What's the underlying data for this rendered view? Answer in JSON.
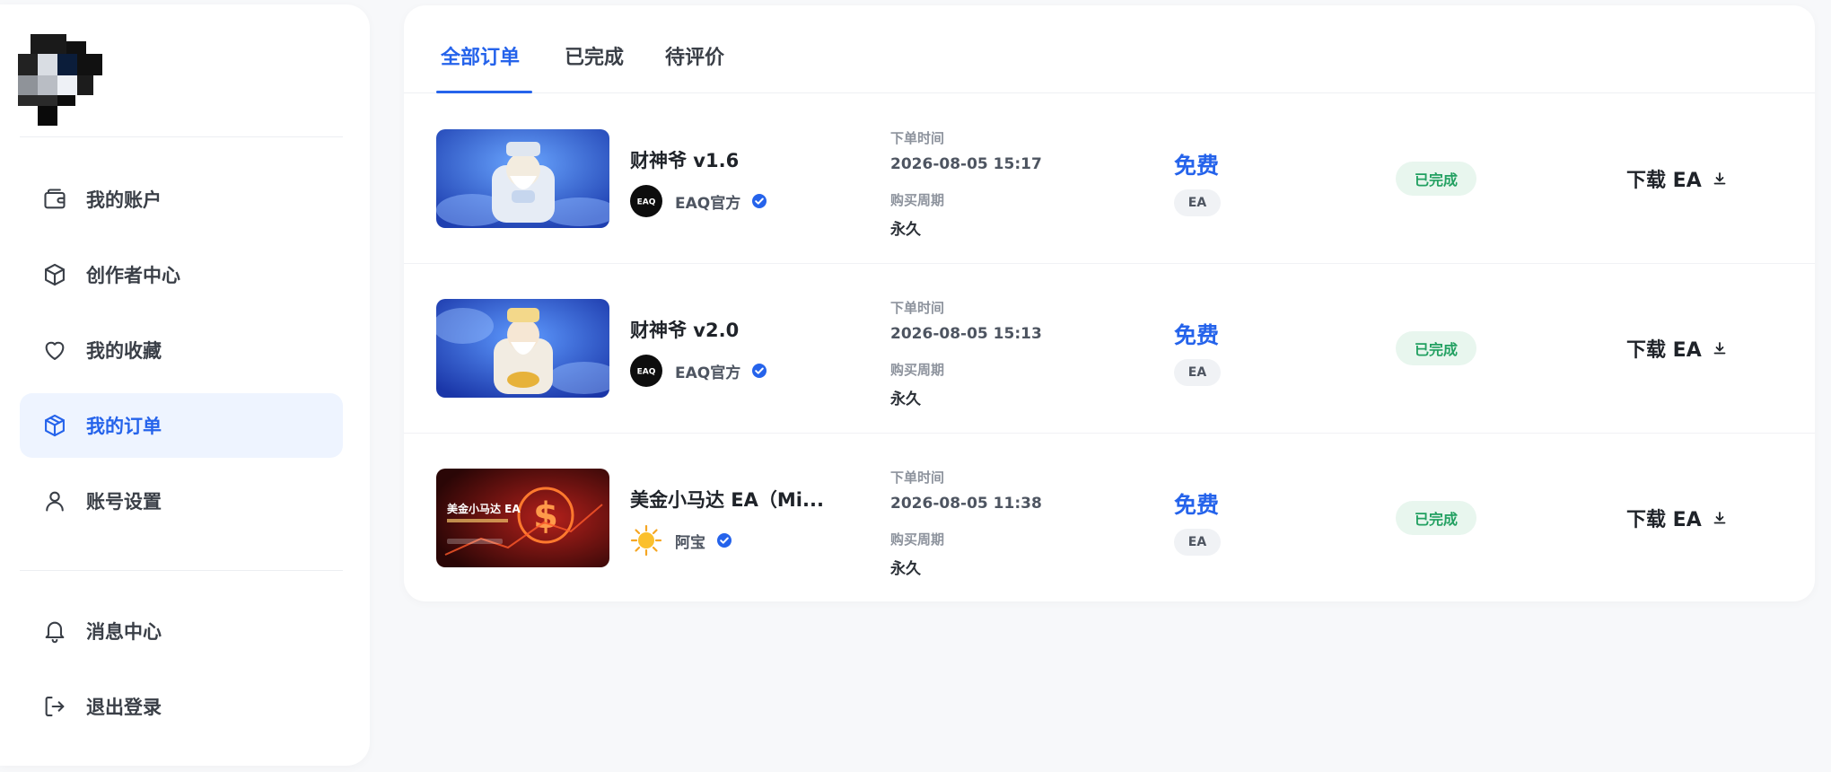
{
  "sidebar": {
    "nav": [
      {
        "label": "我的账户",
        "icon": "wallet-icon"
      },
      {
        "label": "创作者中心",
        "icon": "cube-icon"
      },
      {
        "label": "我的收藏",
        "icon": "heart-icon"
      },
      {
        "label": "我的订单",
        "icon": "package-icon",
        "active": true
      },
      {
        "label": "账号设置",
        "icon": "user-icon"
      }
    ],
    "bottom_nav": [
      {
        "label": "消息中心",
        "icon": "bell-icon"
      },
      {
        "label": "退出登录",
        "icon": "logout-icon"
      }
    ]
  },
  "tabs": [
    {
      "label": "全部订单",
      "active": true
    },
    {
      "label": "已完成"
    },
    {
      "label": "待评价"
    }
  ],
  "orders": [
    {
      "title": "财神爷 v1.6",
      "author": "EAQ官方",
      "author_avatar_text": "EAQ",
      "order_time_label": "下单时间",
      "order_time": "2026-08-05 15:17",
      "period_label": "购买周期",
      "period": "永久",
      "price": "免费",
      "type": "EA",
      "status": "已完成",
      "action": "下载 EA"
    },
    {
      "title": "财神爷 v2.0",
      "author": "EAQ官方",
      "author_avatar_text": "EAQ",
      "order_time_label": "下单时间",
      "order_time": "2026-08-05 15:13",
      "period_label": "购买周期",
      "period": "永久",
      "price": "免费",
      "type": "EA",
      "status": "已完成",
      "action": "下载 EA"
    },
    {
      "title": "美金小马达 EA（Mi...",
      "author": "阿宝",
      "thumb_title": "美金小马达 EA",
      "order_time_label": "下单时间",
      "order_time": "2026-08-05 11:38",
      "period_label": "购买周期",
      "period": "永久",
      "price": "免费",
      "type": "EA",
      "status": "已完成",
      "action": "下载 EA"
    }
  ],
  "colors": {
    "accent": "#2563eb",
    "status_green": "#22a061",
    "status_bg": "#e8f6ee",
    "active_nav_bg": "#eef4ff"
  }
}
